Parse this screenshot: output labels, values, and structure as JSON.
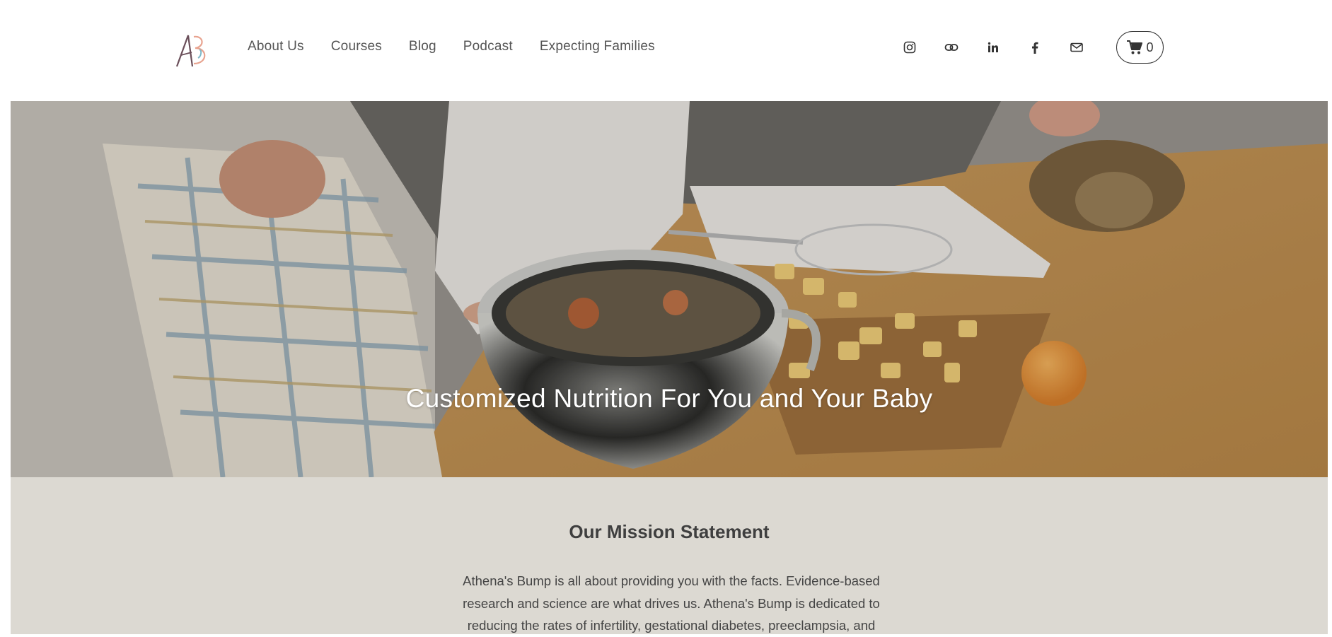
{
  "brand": {
    "logo_icon": "athenas-bump-logo",
    "accent": "#e8a38f"
  },
  "nav": {
    "items": [
      {
        "label": "About Us"
      },
      {
        "label": "Courses"
      },
      {
        "label": "Blog"
      },
      {
        "label": "Podcast"
      },
      {
        "label": "Expecting Families"
      }
    ]
  },
  "social": {
    "icons": [
      "instagram-icon",
      "link-icon",
      "linkedin-icon",
      "facebook-icon",
      "email-icon"
    ]
  },
  "cart": {
    "icon": "cart-icon",
    "count": "0"
  },
  "hero": {
    "title": "Customized Nutrition For You and Your Baby"
  },
  "mission": {
    "heading": "Our Mission Statement",
    "body": "Athena's Bump is all about providing you with the facts. Evidence-based research and science are what drives us. Athena's Bump is dedicated to reducing the rates of infertility, gestational diabetes, preeclampsia, and"
  },
  "colors": {
    "mission_bg": "#dcd9d2",
    "text": "#444444",
    "hero_text": "#ffffff"
  }
}
